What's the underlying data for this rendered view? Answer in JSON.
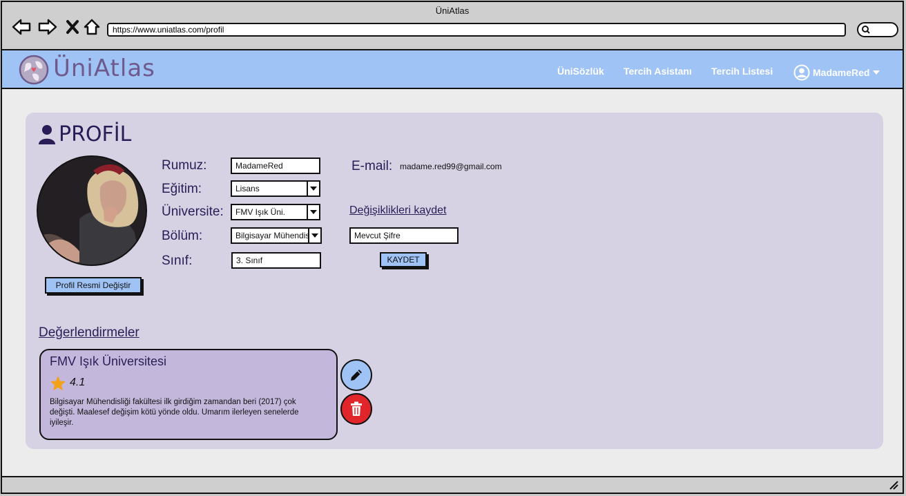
{
  "window": {
    "title": "ÜniAtlas"
  },
  "browser": {
    "url": "https://www.uniatlas.com/profil"
  },
  "header": {
    "brand": "ÜniAtlas",
    "nav": [
      "ÜniSözlük",
      "Tercih Asistanı",
      "Tercih Listesi"
    ],
    "user": "MadameRed"
  },
  "profile": {
    "title": "PROFİL",
    "change_photo_label": "Profil Resmi Değiştir",
    "labels": {
      "nickname": "Rumuz:",
      "education": "Eğitim:",
      "university": "Üniversite:",
      "department": "Bölüm:",
      "grade": "Sınıf:",
      "email": "E-mail:"
    },
    "values": {
      "nickname": "MadameRed",
      "education": "Lisans",
      "university": "FMV Işık Üni.",
      "department": "Bilgisayar Mühendisliği",
      "grade": "3. Sınıf",
      "email": "madame.red99@gmail.com"
    },
    "save_changes_label": "Değişiklikleri kaydet",
    "current_password_placeholder": "Mevcut Şifre",
    "save_button_label": "KAYDET"
  },
  "reviews": {
    "title": "Değerlendirmeler",
    "items": [
      {
        "university": "FMV Işık Üniversitesi",
        "rating": "4.1",
        "text": "Bilgisayar Mühendisliği fakültesi ilk girdiğim zamandan beri (2017) çok değişti. Maalesef değişim kötü yönde oldu. Umarım ilerleyen senelerde iyileşir."
      }
    ]
  },
  "colors": {
    "accent": "#9fc3f5",
    "panel": "#d6d1e3",
    "review_card": "#c3b8dc",
    "delete": "#e0262a",
    "heading": "#2a1d57"
  }
}
